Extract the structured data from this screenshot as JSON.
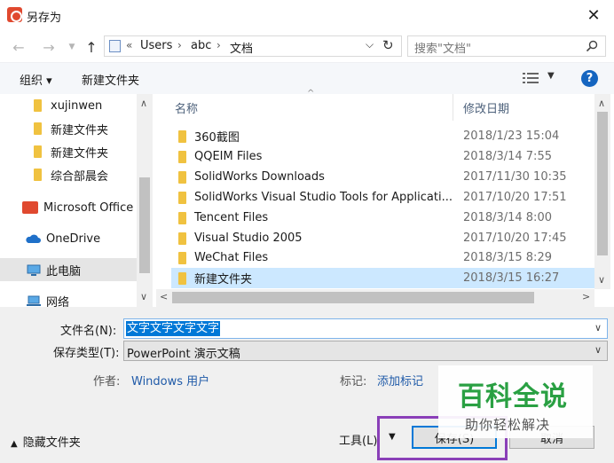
{
  "window": {
    "title": "另存为"
  },
  "nav": {
    "breadcrumbs": [
      "Users",
      "abc",
      "文档"
    ],
    "overflow": "«",
    "search_placeholder": "搜索\"文档\""
  },
  "toolbar": {
    "organize": "组织 ▾",
    "new_folder": "新建文件夹"
  },
  "sidebar": {
    "items": [
      {
        "label": "xujinwen",
        "icon": "folder-icon"
      },
      {
        "label": "新建文件夹",
        "icon": "folder-icon"
      },
      {
        "label": "新建文件夹",
        "icon": "folder-icon"
      },
      {
        "label": "综合部晨会",
        "icon": "folder-icon"
      },
      {
        "label": "Microsoft Office",
        "icon": "office-icon"
      },
      {
        "label": "OneDrive",
        "icon": "cloud-icon"
      },
      {
        "label": "此电脑",
        "icon": "computer-icon"
      },
      {
        "label": "网络",
        "icon": "network-icon"
      }
    ]
  },
  "filelist": {
    "columns": {
      "name": "名称",
      "date": "修改日期"
    },
    "rows": [
      {
        "name": "360截图",
        "date": "2018/1/23 15:04"
      },
      {
        "name": "QQEIM Files",
        "date": "2018/3/14 7:55"
      },
      {
        "name": "SolidWorks Downloads",
        "date": "2017/11/30 10:35"
      },
      {
        "name": "SolidWorks Visual Studio Tools for Applicati...",
        "date": "2017/10/20 17:51"
      },
      {
        "name": "Tencent Files",
        "date": "2018/3/14 8:00"
      },
      {
        "name": "Visual Studio 2005",
        "date": "2017/10/20 17:45"
      },
      {
        "name": "WeChat Files",
        "date": "2018/3/15 8:29"
      },
      {
        "name": "新建文件夹",
        "date": "2018/3/15 16:27"
      }
    ]
  },
  "form": {
    "filename_label": "文件名(N):",
    "filename_value": "文字文字文字文字",
    "type_label": "保存类型(T):",
    "type_value": "PowerPoint 演示文稿",
    "author_label": "作者:",
    "author_value": "Windows 用户",
    "tags_label": "标记:",
    "tags_value": "添加标记"
  },
  "footer": {
    "hide_folders": "隐藏文件夹",
    "tools": "工具(L)",
    "save": "保存(S)",
    "cancel": "取消"
  },
  "watermark": {
    "title": "百科全说",
    "subtitle": "助你轻松解决"
  }
}
